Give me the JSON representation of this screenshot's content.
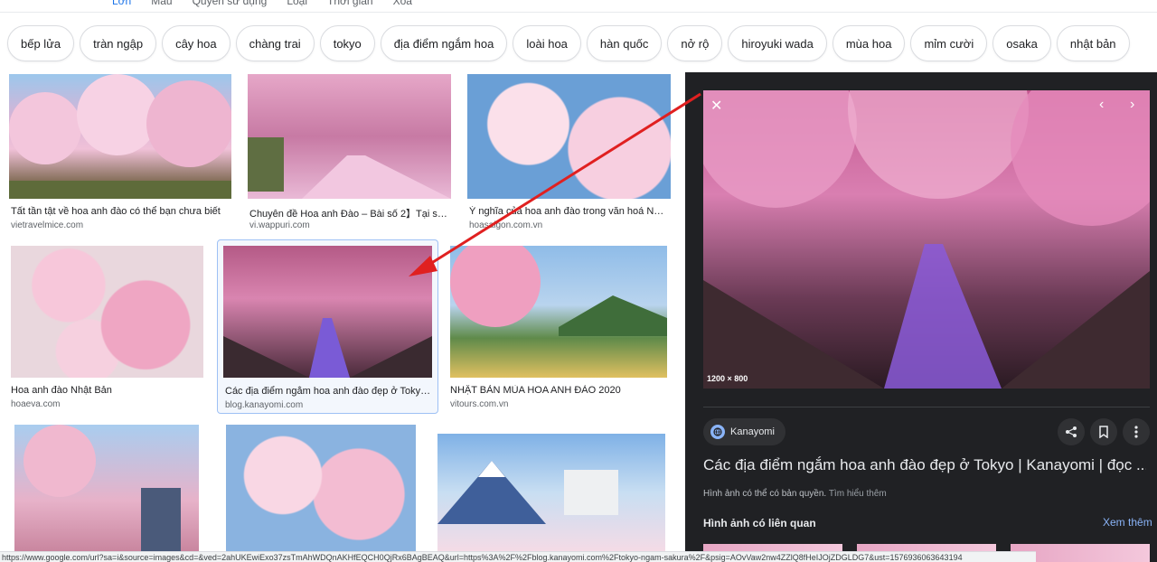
{
  "toolbar": {
    "items": [
      "Lớn",
      "Màu",
      "Quyền sử dụng",
      "Loại",
      "Thời gian",
      "Xóa"
    ]
  },
  "chips": [
    "bếp lửa",
    "tràn ngập",
    "cây hoa",
    "chàng trai",
    "tokyo",
    "địa điểm ngắm hoa",
    "loài hoa",
    "hàn quốc",
    "nở rộ",
    "hiroyuki wada",
    "mùa hoa",
    "mỉm cười",
    "osaka",
    "nhật bản"
  ],
  "results": [
    {
      "caption": "Tất tần tật về hoa anh đào có thể bạn chưa biết",
      "source": "vietravelmice.com"
    },
    {
      "caption": "Chuyên đề Hoa anh Đào – Bài số 2】Tại sao n...",
      "source": "vi.wappuri.com"
    },
    {
      "caption": "Ý nghĩa của hoa anh đào trong văn hoá Nhật B...",
      "source": "hoasaigon.com.vn"
    },
    {
      "caption": "Hoa anh đào Nhật Bản",
      "source": "hoaeva.com"
    },
    {
      "caption": "Các địa điểm ngắm hoa anh đào đẹp ở Tokyo | K...",
      "source": "blog.kanayomi.com"
    },
    {
      "caption": "NHẬT BẢN MÙA HOA ANH ĐÀO 2020",
      "source": "vitours.com.vn"
    }
  ],
  "panel": {
    "dimensions": "1200 × 800",
    "site": "Kanayomi",
    "title": "Các địa điểm ngắm hoa anh đào đẹp ở Tokyo | Kanayomi | đọc ...",
    "copyright": "Hình ảnh có thể có bản quyền.",
    "learn_more": "Tìm hiểu thêm",
    "related": "Hình ảnh có liên quan",
    "see_more": "Xem thêm"
  },
  "status_url": "https://www.google.com/url?sa=i&source=images&cd=&ved=2ahUKEwiExo37zsTmAhWDQnAKHfEQCH0QjRx6BAgBEAQ&url=https%3A%2F%2Fblog.kanayomi.com%2Ftokyo-ngam-sakura%2F&psig=AOvVaw2nw4ZZlQ8fHeIJOjZDGLDG7&ust=1576936063643194",
  "colors": {
    "accent": "#1a73e8",
    "panel_bg": "#202124",
    "arrow": "#e02020",
    "link_dark": "#8ab4f8"
  }
}
